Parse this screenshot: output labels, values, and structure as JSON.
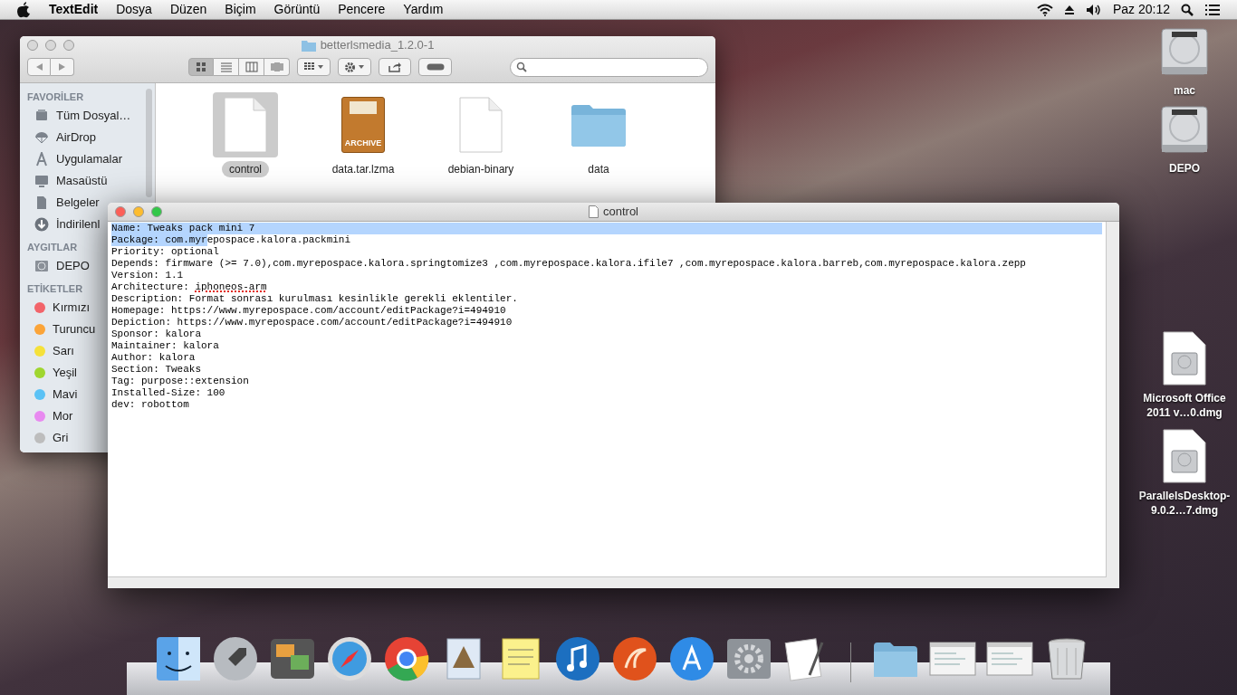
{
  "menu_bar": {
    "app_name": "TextEdit",
    "menus": [
      "Dosya",
      "Düzen",
      "Biçim",
      "Görüntü",
      "Pencere",
      "Yardım"
    ],
    "clock": "Paz 20:12"
  },
  "finder_window": {
    "title": "betterlsmedia_1.2.0-1",
    "active": false,
    "view_buttons": [
      {
        "kind": "icons",
        "selected": true
      },
      {
        "kind": "list",
        "selected": false
      },
      {
        "kind": "columns",
        "selected": false
      },
      {
        "kind": "coverflow",
        "selected": false
      }
    ],
    "sidebar": [
      {
        "heading": "FAVORİLER",
        "items": [
          {
            "label": "Tüm Dosyal…",
            "kind": "all-files"
          },
          {
            "label": "AirDrop",
            "kind": "airdrop"
          },
          {
            "label": "Uygulamalar",
            "kind": "apps"
          },
          {
            "label": "Masaüstü",
            "kind": "desktop"
          },
          {
            "label": "Belgeler",
            "kind": "documents"
          },
          {
            "label": "İndirilenl",
            "kind": "downloads"
          }
        ]
      },
      {
        "heading": "AYGITLAR",
        "items": [
          {
            "label": "DEPO",
            "kind": "drive"
          }
        ]
      },
      {
        "heading": "ETİKETLER",
        "items": [
          {
            "label": "Kırmızı",
            "kind": "tag",
            "color": "#f2646a"
          },
          {
            "label": "Turuncu",
            "kind": "tag",
            "color": "#fba438"
          },
          {
            "label": "Sarı",
            "kind": "tag",
            "color": "#f5e13a"
          },
          {
            "label": "Yeşil",
            "kind": "tag",
            "color": "#9fd62f"
          },
          {
            "label": "Mavi",
            "kind": "tag",
            "color": "#5bc2f5"
          },
          {
            "label": "Mor",
            "kind": "tag",
            "color": "#e88af0"
          },
          {
            "label": "Gri",
            "kind": "tag",
            "color": "#bdbdbd"
          }
        ]
      }
    ],
    "files": [
      {
        "name": "control",
        "kind": "document",
        "selected": true
      },
      {
        "name": "data.tar.lzma",
        "kind": "archive",
        "badge": "ARCHIVE",
        "selected": false
      },
      {
        "name": "debian-binary",
        "kind": "document",
        "selected": false
      },
      {
        "name": "data",
        "kind": "folder",
        "selected": false
      }
    ]
  },
  "text_window": {
    "title": "control",
    "active": true,
    "lines": [
      {
        "segments": [
          {
            "text": "Name: Tweaks pack mini 7",
            "selected": true,
            "misspelled": false
          }
        ],
        "selected_to_end": true
      },
      {
        "segments": [
          {
            "text": "Package: com.myr",
            "selected": true,
            "misspelled": false
          },
          {
            "text": "epospace.kalora.packmini",
            "selected": false,
            "misspelled": false
          }
        ],
        "selected_to_end": false
      },
      {
        "segments": [
          {
            "text": "Priority: optional",
            "selected": false,
            "misspelled": false
          }
        ],
        "selected_to_end": false
      },
      {
        "segments": [
          {
            "text": "Depends: firmware (>= 7.0),com.myrepospace.kalora.springtomize3 ,com.myrepospace.kalora.ifile7 ,com.myrepospace.kalora.barreb,com.myrepospace.kalora.zepp",
            "selected": false,
            "misspelled": false
          }
        ],
        "selected_to_end": false
      },
      {
        "segments": [
          {
            "text": "Version: 1.1",
            "selected": false,
            "misspelled": false
          }
        ],
        "selected_to_end": false
      },
      {
        "segments": [
          {
            "text": "Architecture: ",
            "selected": false,
            "misspelled": false
          },
          {
            "text": "iphoneos-arm",
            "selected": false,
            "misspelled": true
          }
        ],
        "selected_to_end": false
      },
      {
        "segments": [
          {
            "text": "Description: Format sonrası kurulması kesinlikle gerekli eklentiler.",
            "selected": false,
            "misspelled": false
          }
        ],
        "selected_to_end": false
      },
      {
        "segments": [
          {
            "text": "Homepage: https://www.myrepospace.com/account/editPackage?i=494910",
            "selected": false,
            "misspelled": false
          }
        ],
        "selected_to_end": false
      },
      {
        "segments": [
          {
            "text": "Depiction: https://www.myrepospace.com/account/editPackage?i=494910",
            "selected": false,
            "misspelled": false
          }
        ],
        "selected_to_end": false
      },
      {
        "segments": [
          {
            "text": "Sponsor: kalora",
            "selected": false,
            "misspelled": false
          }
        ],
        "selected_to_end": false
      },
      {
        "segments": [
          {
            "text": "Maintainer: kalora",
            "selected": false,
            "misspelled": false
          }
        ],
        "selected_to_end": false
      },
      {
        "segments": [
          {
            "text": "Author: kalora",
            "selected": false,
            "misspelled": false
          }
        ],
        "selected_to_end": false
      },
      {
        "segments": [
          {
            "text": "Section: Tweaks",
            "selected": false,
            "misspelled": false
          }
        ],
        "selected_to_end": false
      },
      {
        "segments": [
          {
            "text": "Tag: purpose::extension",
            "selected": false,
            "misspelled": false
          }
        ],
        "selected_to_end": false
      },
      {
        "segments": [
          {
            "text": "Installed-Size: 100",
            "selected": false,
            "misspelled": false
          }
        ],
        "selected_to_end": false
      },
      {
        "segments": [
          {
            "text": "dev: robottom",
            "selected": false,
            "misspelled": false
          }
        ],
        "selected_to_end": false
      }
    ]
  },
  "desktop_icons": [
    {
      "label": "mac",
      "kind": "drive"
    },
    {
      "label": "DEPO",
      "kind": "drive"
    },
    {
      "label": "Microsoft Office 2011 v…0.dmg",
      "kind": "disk-image"
    },
    {
      "label": "ParallelsDesktop-9.0.2…7.dmg",
      "kind": "disk-image"
    }
  ],
  "dock": {
    "apps": [
      {
        "kind": "finder"
      },
      {
        "kind": "rocket"
      },
      {
        "kind": "photos"
      },
      {
        "kind": "compass"
      },
      {
        "kind": "chrome"
      },
      {
        "kind": "stamp"
      },
      {
        "kind": "notes"
      },
      {
        "kind": "music"
      },
      {
        "kind": "swirl"
      },
      {
        "kind": "appstore"
      },
      {
        "kind": "gear"
      },
      {
        "kind": "textedit"
      }
    ],
    "others": [
      {
        "kind": "folder"
      },
      {
        "kind": "window"
      },
      {
        "kind": "window"
      },
      {
        "kind": "trash"
      }
    ]
  }
}
